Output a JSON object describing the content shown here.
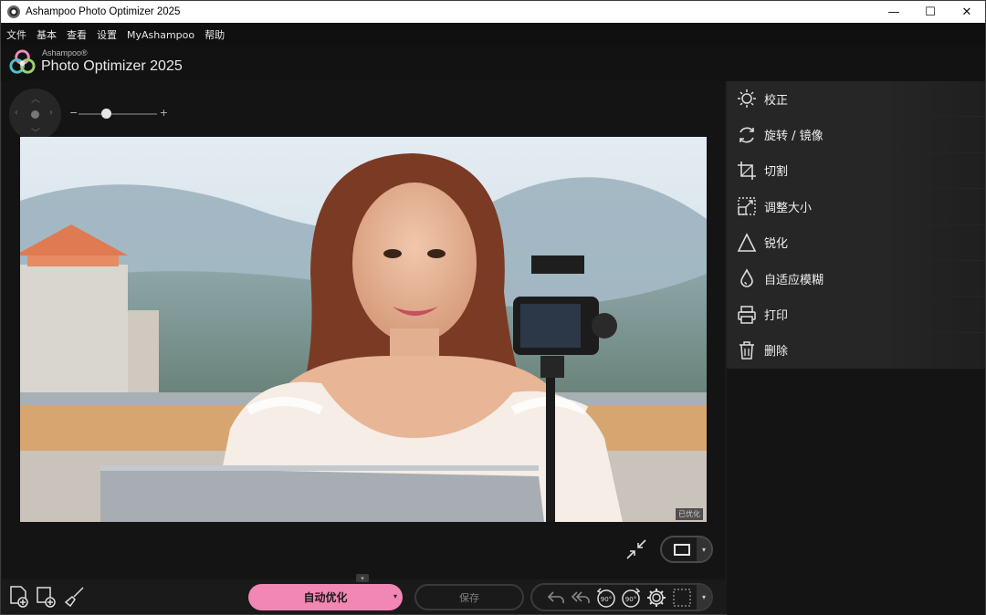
{
  "window": {
    "title": "Ashampoo Photo Optimizer 2025",
    "minimize": "—",
    "maximize": "☐",
    "close": "✕"
  },
  "menu": [
    "文件",
    "基本",
    "查看",
    "设置",
    "MyAshampoo",
    "帮助"
  ],
  "logo": {
    "brand": "Ashampoo®",
    "product": "Photo Optimizer 2025"
  },
  "photo": {
    "badge": "已优化"
  },
  "zoom": {
    "minus": "−",
    "plus": "+",
    "level": 0.35
  },
  "panel": {
    "items": [
      {
        "label": "校正",
        "icon": "sun-icon"
      },
      {
        "label": "旋转 / 镜像",
        "icon": "rotate-icon"
      },
      {
        "label": "切割",
        "icon": "crop-icon"
      },
      {
        "label": "调整大小",
        "icon": "resize-icon"
      },
      {
        "label": "锐化",
        "icon": "triangle-icon"
      },
      {
        "label": "自适应模糊",
        "icon": "drop-icon"
      },
      {
        "label": "打印",
        "icon": "printer-icon"
      },
      {
        "label": "删除",
        "icon": "trash-icon"
      }
    ]
  },
  "bottom": {
    "auto_label": "自动优化",
    "save_label": "保存",
    "rotate_left_label": "90°",
    "rotate_right_label": "90°"
  },
  "colors": {
    "accent": "#f286b4",
    "background": "#141414",
    "panel": "#1f1f1f"
  }
}
